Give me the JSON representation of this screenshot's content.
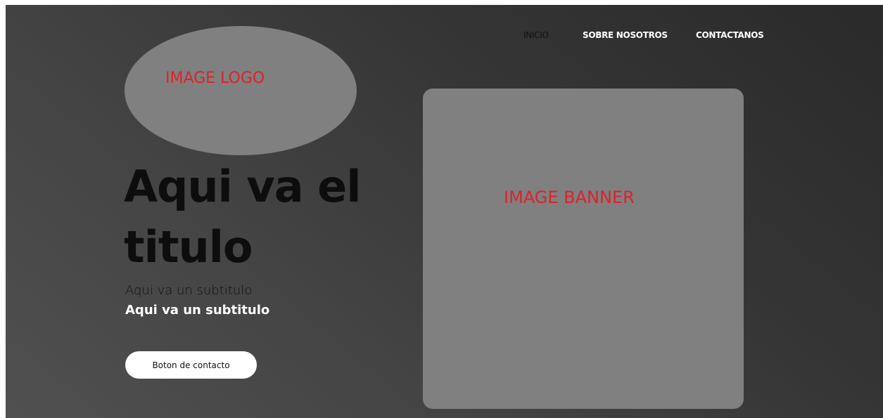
{
  "nav": {
    "items": [
      {
        "label": "INICIO",
        "active": true
      },
      {
        "label": "SOBRE NOSOTROS",
        "active": false
      },
      {
        "label": "CONTACTANOS",
        "active": false
      }
    ]
  },
  "logo": {
    "placeholder_text": "IMAGE LOGO"
  },
  "hero": {
    "title": "Aqui va el titulo",
    "subtitle_light": "Aqui va un subtitulo",
    "subtitle_bold": "Aqui va un subtitulo",
    "cta_label": "Boton de contacto"
  },
  "banner": {
    "placeholder_text": "IMAGE BANNER"
  },
  "colors": {
    "placeholder_fill": "#808080",
    "placeholder_label": "#d8242a",
    "title": "#0d0d0d",
    "button_bg": "#ffffff"
  }
}
